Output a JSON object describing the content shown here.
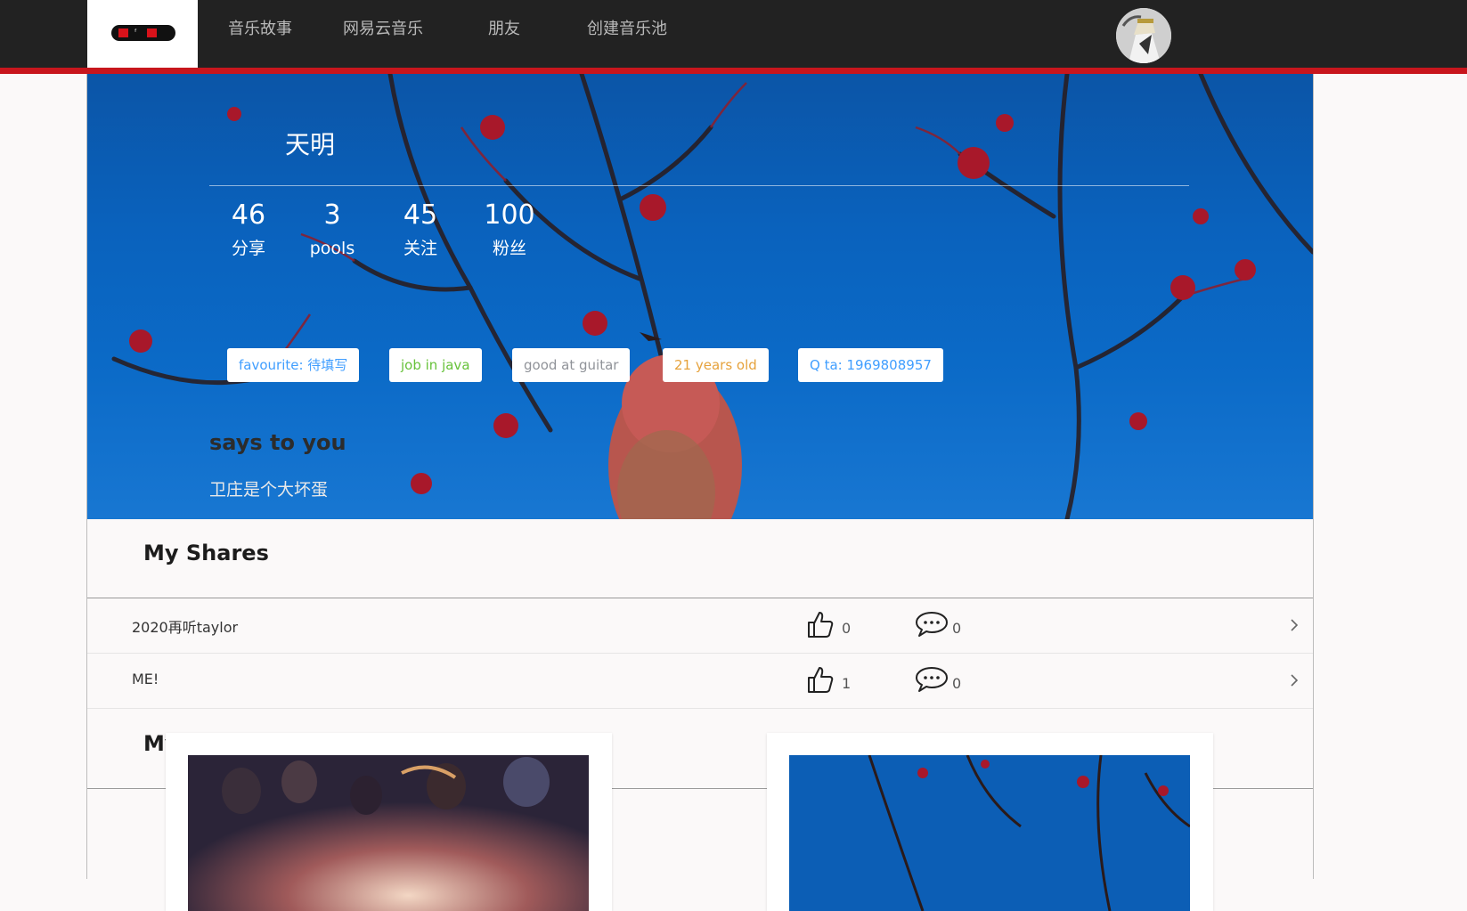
{
  "nav": {
    "logo_text": "FyMu",
    "items": [
      {
        "label": "音乐故事"
      },
      {
        "label": "网易云音乐"
      },
      {
        "label": "朋友"
      },
      {
        "label": "创建音乐池"
      }
    ],
    "accent_color": "#c8161d"
  },
  "profile": {
    "name": "天明",
    "stats": [
      {
        "value": "46",
        "label": "分享"
      },
      {
        "value": "3",
        "label": "pools"
      },
      {
        "value": "45",
        "label": "关注"
      },
      {
        "value": "100",
        "label": "粉丝"
      }
    ],
    "tags": [
      {
        "text": "favourite: 待填写",
        "color": "#409eff"
      },
      {
        "text": "job in java",
        "color": "#67c23a"
      },
      {
        "text": "good at guitar",
        "color": "#909399"
      },
      {
        "text": "21 years old",
        "color": "#e6a23c"
      },
      {
        "text": "Q ta: 1969808957",
        "color": "#409eff"
      }
    ],
    "says_title": "says to you",
    "says_text": "卫庄是个大坏蛋"
  },
  "shares": {
    "title": "My Shares",
    "items": [
      {
        "title": "2020再听taylor",
        "likes": "0",
        "comments": "0"
      },
      {
        "title": "ME!",
        "likes": "1",
        "comments": "0"
      }
    ]
  },
  "pools": {
    "title": "My Pools"
  },
  "icons": {
    "like": "thumbs-up-icon",
    "comment": "comment-bubble-icon",
    "chevron": "chevron-right-icon"
  }
}
